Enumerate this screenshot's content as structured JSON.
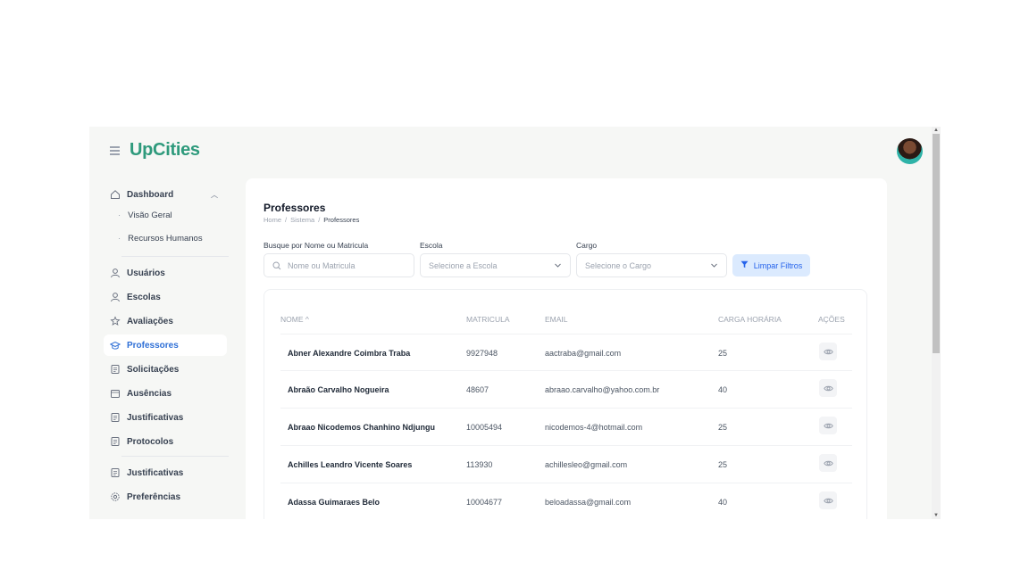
{
  "brand": "UpCities",
  "sidebar": {
    "dashboard": "Dashboard",
    "sub_items": [
      "Visão Geral",
      "Recursos Humanos"
    ],
    "items": [
      "Usuários",
      "Escolas",
      "Avaliações",
      "Professores",
      "Solicitações",
      "Ausências",
      "Justificativas",
      "Protocolos"
    ],
    "items_bottom": [
      "Justificativas",
      "Preferências"
    ],
    "active": "Professores"
  },
  "page": {
    "title": "Professores",
    "breadcrumb": [
      "Home",
      "/",
      "Sistema",
      "/",
      "Professores"
    ]
  },
  "filters": {
    "search_label": "Busque por Nome ou Matricula",
    "search_placeholder": "Nome ou Matricula",
    "school_label": "Escola",
    "school_placeholder": "Selecione a Escola",
    "role_label": "Cargo",
    "role_placeholder": "Selecione o Cargo",
    "clear_button": "Limpar Filtros"
  },
  "table": {
    "headers": [
      "NOME ^",
      "MATRICULA",
      "EMAIL",
      "CARGA HORÁRIA",
      "AÇÕES"
    ],
    "rows": [
      [
        "Abner Alexandre Coimbra Traba",
        "9927948",
        "aactraba@gmail.com",
        "25"
      ],
      [
        "Abraão Carvalho Nogueira",
        "48607",
        "abraao.carvalho@yahoo.com.br",
        "40"
      ],
      [
        "Abraao Nicodemos Chanhino Ndjungu",
        "10005494",
        "nicodemos-4@hotmail.com",
        "25"
      ],
      [
        "Achilles Leandro Vicente Soares",
        "113930",
        "achillesleo@gmail.com",
        "25"
      ],
      [
        "Adassa Guimaraes Belo",
        "10004677",
        "beloadassa@gmail.com",
        "40"
      ]
    ]
  },
  "colors": {
    "brand": "#2e9a7c",
    "active_nav": "#2e6fd6",
    "clear_button_bg": "#dbeafe"
  }
}
